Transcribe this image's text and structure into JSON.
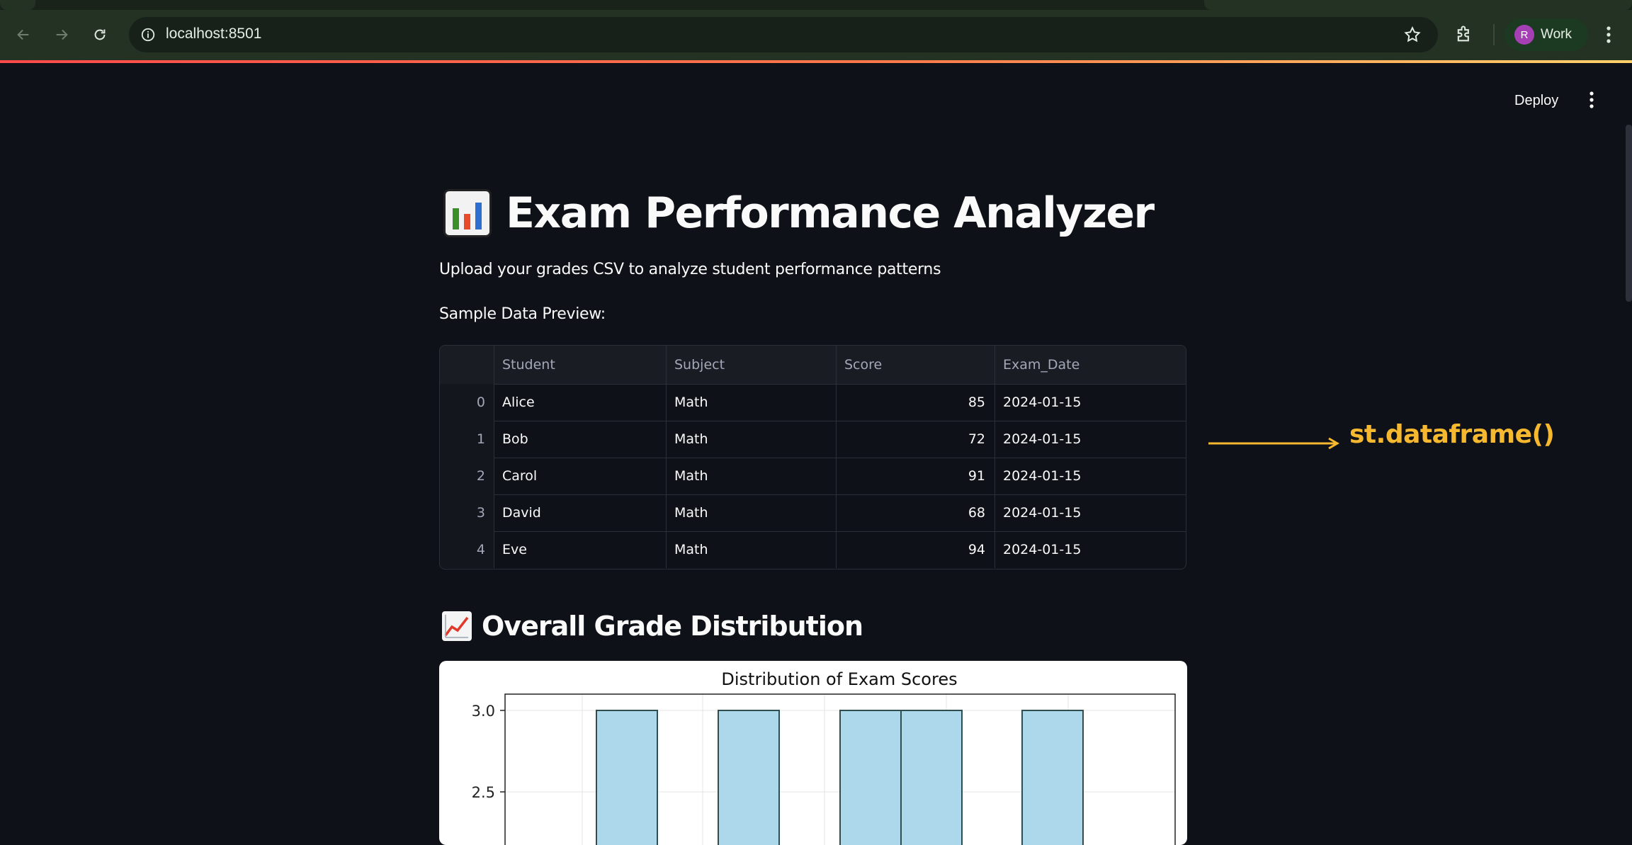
{
  "browser": {
    "url": "localhost:8501",
    "profile_initial": "R",
    "profile_name": "Work"
  },
  "header": {
    "deploy_label": "Deploy"
  },
  "page": {
    "title": "Exam Performance Analyzer",
    "subtitle": "Upload your grades CSV to analyze student performance patterns",
    "preview_label": "Sample Data Preview:"
  },
  "table": {
    "columns": [
      "",
      "Student",
      "Subject",
      "Score",
      "Exam_Date"
    ],
    "rows": [
      [
        "0",
        "Alice",
        "Math",
        "85",
        "2024-01-15"
      ],
      [
        "1",
        "Bob",
        "Math",
        "72",
        "2024-01-15"
      ],
      [
        "2",
        "Carol",
        "Math",
        "91",
        "2024-01-15"
      ],
      [
        "3",
        "David",
        "Math",
        "68",
        "2024-01-15"
      ],
      [
        "4",
        "Eve",
        "Math",
        "94",
        "2024-01-15"
      ]
    ]
  },
  "annotation": {
    "text": "st.dataframe()",
    "color": "#f5b82e"
  },
  "section": {
    "title": "Overall Grade Distribution"
  },
  "chart_data": {
    "type": "bar",
    "title": "Distribution of Exam Scores",
    "ylabel": "",
    "yticks": [
      "3.0",
      "2.5"
    ],
    "ylim": [
      2.0,
      3.1
    ],
    "bar_color": "#add8ec",
    "bar_heights": [
      3,
      3,
      3,
      3,
      3
    ]
  },
  "colors": {
    "background": "#0e1117",
    "accent": "#ff4b4b"
  }
}
